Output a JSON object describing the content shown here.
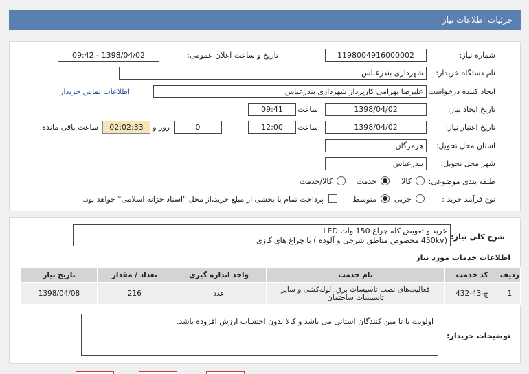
{
  "header": {
    "title": "جزئیات اطلاعات نیاز"
  },
  "form": {
    "need_number_label": "شماره نیاز:",
    "need_number": "1198004916000002",
    "announce_label": "تاریخ و ساعت اعلان عمومی:",
    "announce_value": "1398/04/02 - 09:42",
    "buyer_org_label": "نام دستگاه خریدار:",
    "buyer_org": "شهرداری بندرعباس",
    "creator_label": "ایجاد کننده درخواست:",
    "creator": "علیرضا بهرامی کارپرداز شهرداری بندرعباس",
    "contact_link": "اطلاعات تماس خریدار",
    "created_date_label": "تاریخ ایجاد نیاز:",
    "created_date": "1398/04/02",
    "time_label": "ساعت",
    "created_time": "09:41",
    "validity_label": "تاریخ اعتبار نیاز:",
    "validity_date": "1398/04/02",
    "validity_time": "12:00",
    "days_value": "0",
    "days_label": "روز و",
    "remaining_time": "02:02:33",
    "remaining_label": "ساعت باقی مانده",
    "province_label": "استان محل تحویل:",
    "province": "هرمزگان",
    "city_label": "شهر محل تحویل:",
    "city": "بندرعباس",
    "category_label": "طبقه بندی موضوعی:",
    "category_options": [
      "کالا",
      "خدمت",
      "کالا/خدمت"
    ],
    "category_selected": "خدمت",
    "process_label": "نوع فرآیند خرید :",
    "process_options": [
      "جزیی",
      "متوسط"
    ],
    "process_selected": "متوسط",
    "payment_note": "پرداخت تمام یا بخشی از مبلغ خرید،از محل \"اسناد خزانه اسلامی\" خواهد بود."
  },
  "summary": {
    "label": "شرح کلی نیاز:",
    "line1": "خرید و تعویض کله چراغ 150 وات LED",
    "line2": "(450kv مخصوص مناطق شرجی و آلوده ) با چراغ های گازی"
  },
  "services": {
    "title": "اطلاعات خدمات مورد نیاز",
    "columns": [
      "ردیف",
      "کد خدمت",
      "نام خدمت",
      "واحد اندازه گیری",
      "تعداد / مقدار",
      "تاریخ نیاز"
    ],
    "rows": [
      [
        "1",
        "ج-43-432",
        "فعالیت‌های نصب تاسیسات برق، لوله‌کشی و سایر تاسیسات ساختمان",
        "عدد",
        "216",
        "1398/04/08"
      ]
    ]
  },
  "buyer_notes": {
    "label": "توضیحات خریدار:",
    "text": "اولویت با تا مین کنندگان استانی می باشد و کالا بدون احتساب ارزش افزوده باشد."
  }
}
